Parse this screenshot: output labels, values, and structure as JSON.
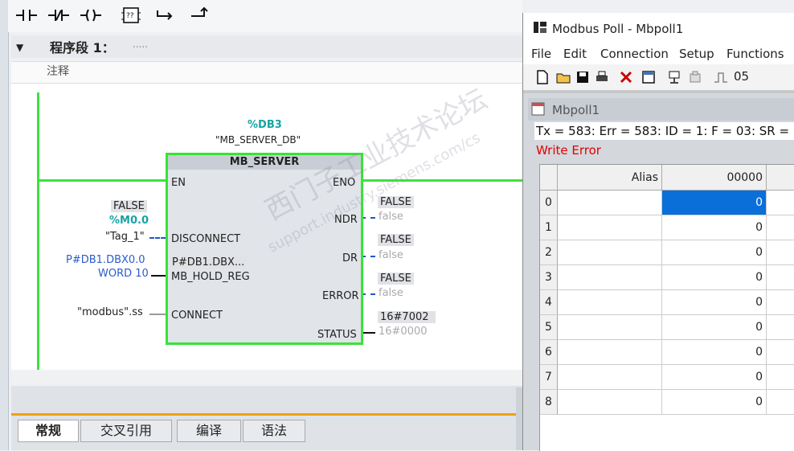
{
  "toolbar": {
    "icons": [
      "contact-no-icon",
      "contact-nc-icon",
      "coil-icon",
      "empty-box-icon",
      "open-branch-icon",
      "close-branch-icon"
    ]
  },
  "segment": {
    "title": "程序段 1：",
    "dots": ".....",
    "comment": "注释"
  },
  "block": {
    "db_address": "%DB3",
    "db_name": "\"MB_SERVER_DB\"",
    "name": "MB_SERVER",
    "inputs": {
      "en": "EN",
      "disconnect": "DISCONNECT",
      "hold_reg": "MB_HOLD_REG",
      "connect": "CONNECT"
    },
    "outputs": {
      "eno": "ENO",
      "ndr": "NDR",
      "dr": "DR",
      "error": "ERROR",
      "status": "STATUS"
    },
    "disconnect_val": "FALSE",
    "disconnect_addr": "%M0.0",
    "disconnect_tag": "\"Tag_1\"",
    "hold_reg_ptr": "P#DB1.DBX0.0",
    "hold_reg_len": "WORD 10",
    "hold_reg_inner": "P#DB1.DBX...",
    "connect_tag": "\"modbus\".ss",
    "ndr_val": "FALSE",
    "ndr_state": "false",
    "dr_val": "FALSE",
    "dr_state": "false",
    "error_val": "FALSE",
    "error_state": "false",
    "status_val": "16#7002",
    "status_state": "16#0000"
  },
  "bottom_tabs": [
    "常规",
    "交叉引用",
    "编译",
    "语法"
  ],
  "modbus": {
    "title": "Modbus Poll - Mbpoll1",
    "menu": [
      "File",
      "Edit",
      "Connection",
      "Setup",
      "Functions"
    ],
    "toolbar_text": "05",
    "child_title": "Mbpoll1",
    "status": "Tx = 583: Err = 583: ID = 1: F = 03: SR =",
    "error": "Write Error",
    "col_alias": "Alias",
    "col_addr": "00000",
    "rows": [
      {
        "idx": "0",
        "value": "0"
      },
      {
        "idx": "1",
        "value": "0"
      },
      {
        "idx": "2",
        "value": "0"
      },
      {
        "idx": "3",
        "value": "0"
      },
      {
        "idx": "4",
        "value": "0"
      },
      {
        "idx": "5",
        "value": "0"
      },
      {
        "idx": "6",
        "value": "0"
      },
      {
        "idx": "7",
        "value": "0"
      },
      {
        "idx": "8",
        "value": "0"
      }
    ]
  },
  "watermark": {
    "line1": "西门子工业技术论坛",
    "line2": "support.industry.siemens.com/cs"
  },
  "colors": {
    "wire_active": "#3ee23e",
    "teal": "#16a3a3",
    "error_red": "#e00000",
    "selection": "#0a6fd8",
    "tab_accent": "#f0a010"
  }
}
